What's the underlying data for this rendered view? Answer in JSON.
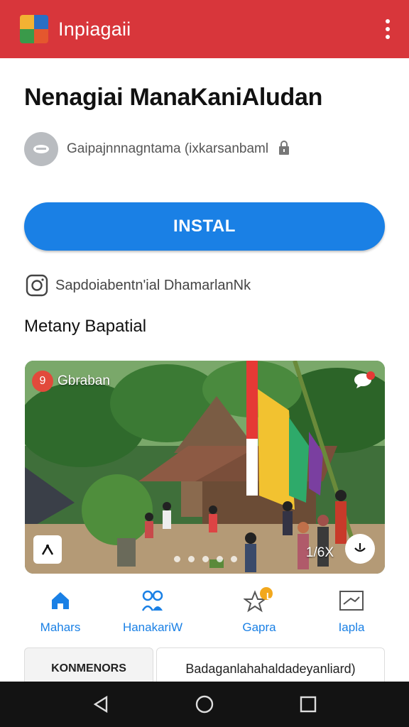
{
  "appbar": {
    "title": "Inpiagaii",
    "menu_icon": "more-vert-icon",
    "logo_icon": "app-logo-icon",
    "color": "#d8363b"
  },
  "app": {
    "title": "Nenagiai ManaKaniAludan",
    "developer": "Gaipajnnnagntama (ixkarsanbaml",
    "developer_icon": "developer-avatar-icon",
    "lock_icon": "lock-icon"
  },
  "install": {
    "label": "INSTAL",
    "color": "#1a80e5"
  },
  "instagram": {
    "text": "Sapdoiabentn'ial DhamarlanNk",
    "icon": "instagram-icon"
  },
  "section": {
    "title": "Metany Bapatial"
  },
  "media": {
    "badge_num": "9",
    "badge_label": "Gbraban",
    "counter": "1/6X",
    "slide_count": 5,
    "current_slide": 1
  },
  "nav": {
    "items": [
      {
        "label": "Mahars",
        "icon": "home-icon"
      },
      {
        "label": "HanakariW",
        "icon": "people-icon"
      },
      {
        "label": "Gapra",
        "icon": "star-badge-icon",
        "badge": "L"
      },
      {
        "label": "Iapla",
        "icon": "folder-icon"
      }
    ],
    "active_color": "#1a80e5"
  },
  "tabs": {
    "tab1": "KONMENORS",
    "tab2": "Badaganlahahaldadeyanliard)"
  },
  "sysnav": {
    "back_icon": "back-icon",
    "home_icon": "home-circle-icon",
    "recents_icon": "recents-icon"
  }
}
